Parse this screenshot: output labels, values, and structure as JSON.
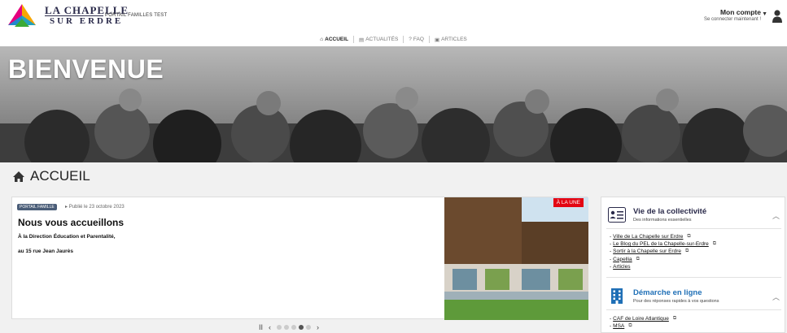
{
  "brand": {
    "line1": "LA CHAPELLE",
    "line2": "SUR ERDRE",
    "portal_tag": "PORTAIL FAMILLES TEST"
  },
  "account": {
    "title": "Mon compte",
    "subtitle": "Se connecter maintenant !"
  },
  "nav": [
    {
      "icon": "home-icon",
      "label": "ACCUEIL",
      "active": true
    },
    {
      "icon": "news-icon",
      "label": "ACTUALITÉS",
      "active": false
    },
    {
      "icon": "help-icon",
      "label": "FAQ",
      "active": false
    },
    {
      "icon": "article-icon",
      "label": "ARTICLES",
      "active": false
    }
  ],
  "hero": {
    "title": "BIENVENUE"
  },
  "section": {
    "title": "ACCUEIL"
  },
  "news": {
    "tag": "PORTAIL FAMILLE",
    "published": "Publié le 23 octobre 2023",
    "title": "Nous vous accueillons",
    "line1": "À la Direction Éducation et Parentalité,",
    "line2": "au 15 rue Jean Jaurès",
    "badge": "À LA UNE"
  },
  "slider": {
    "pause": "II",
    "prev": "‹",
    "next": "›",
    "total": 5,
    "active_index": 3
  },
  "sidebar": {
    "vie": {
      "title": "Vie de la collectivité",
      "subtitle": "Des informations essentielles",
      "links": [
        "Ville de La Chapelle sur Erdre",
        "Le Blog du PEL de la Chapelle-sur-Erdre",
        "Sortir à la Chapelle sur Erdre",
        "Capellia",
        "Articles"
      ]
    },
    "demarche": {
      "title": "Démarche en ligne",
      "subtitle": "Pour des réponses rapides à vos questions",
      "links": [
        "CAF de Loire Atlantique",
        "MSA"
      ]
    }
  },
  "colors": {
    "accent": "#2a2a4a",
    "badge_red": "#e30613",
    "tag_blue": "#4a5d78",
    "icon_blue": "#1f6fb6"
  }
}
